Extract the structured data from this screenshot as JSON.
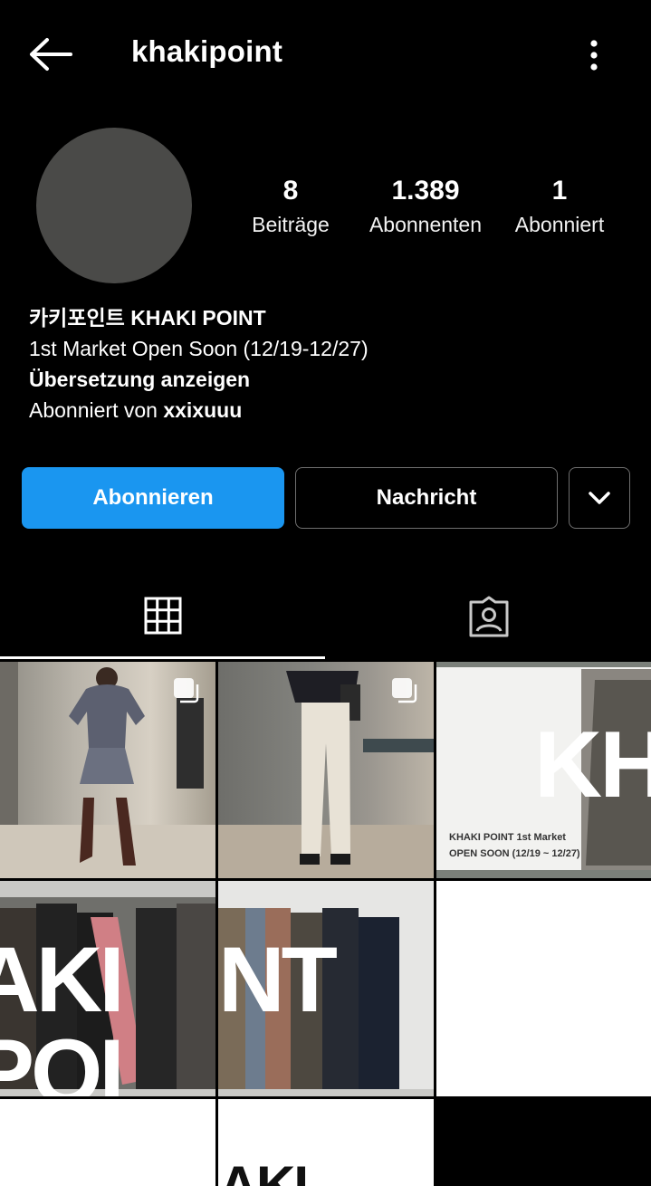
{
  "header": {
    "username": "khakipoint",
    "back_icon": "arrow-left-icon",
    "more_icon": "more-vertical-icon"
  },
  "stats": {
    "posts": {
      "value": "8",
      "label": "Beiträge"
    },
    "followers": {
      "value": "1.389",
      "label": "Abonnenten"
    },
    "following": {
      "value": "1",
      "label": "Abonniert"
    }
  },
  "bio": {
    "name": "카키포인트 KHAKI POINT",
    "text": "1st Market Open Soon (12/19-12/27)",
    "translate": "Übersetzung anzeigen",
    "followed_by_prefix": "Abonniert von ",
    "followed_by_user": "xxixuuu"
  },
  "actions": {
    "follow": "Abonnieren",
    "message": "Nachricht",
    "dropdown_icon": "chevron-down-icon"
  },
  "tabs": [
    {
      "icon": "grid-icon",
      "active": true
    },
    {
      "icon": "tagged-user-icon",
      "active": false
    }
  ],
  "posts_grid": {
    "tile3_big": "KHA",
    "tile3_caption_line1": "KHAKI POINT  1st Market",
    "tile3_caption_line2": "OPEN SOON (12/19 ~ 12/27)",
    "tile4_big": "AKI POI",
    "tile5_big": "NT",
    "tile8_big": "KHAKI"
  },
  "colors": {
    "background": "#000000",
    "primary_button": "#1a96f0",
    "avatar_placeholder": "#4a4a48"
  }
}
